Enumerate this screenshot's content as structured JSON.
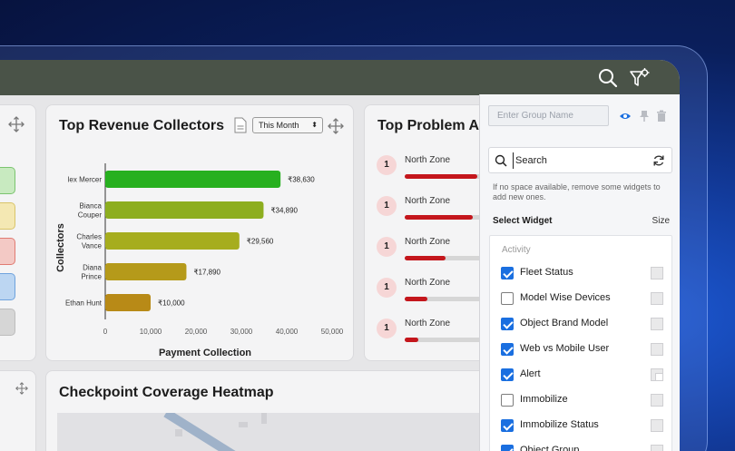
{
  "header": {
    "search_icon": "search-icon",
    "filter_settings_icon": "filter-settings-icon"
  },
  "revenue_card": {
    "title": "Top Revenue Collectors",
    "period_select": "This Month",
    "chart_data": {
      "type": "bar",
      "orientation": "horizontal",
      "categories": [
        "lex Mercer",
        "Bianca Couper",
        "Charles Vance",
        "Diana Prince",
        "Ethan Hunt"
      ],
      "category_lines": [
        [
          "lex Mercer"
        ],
        [
          "Bianca",
          "Couper"
        ],
        [
          "Charles",
          "Vance"
        ],
        [
          "Diana",
          "Prince"
        ],
        [
          "Ethan Hunt"
        ]
      ],
      "values": [
        38630,
        34890,
        29560,
        17890,
        10000
      ],
      "value_labels": [
        "₹38,630",
        "₹34,890",
        "₹29,560",
        "₹17,890",
        "₹10,000"
      ],
      "xlabel": "Payment Collection",
      "ylabel": "Collectors",
      "xlim": [
        0,
        50000
      ],
      "xticks": [
        "0",
        "10,000",
        "20,000",
        "30,000",
        "40,000",
        "50,000"
      ],
      "colors": [
        "#27b01f",
        "#8dae1f",
        "#a6ad1e",
        "#b59a1a",
        "#b88a17"
      ]
    }
  },
  "problem_card": {
    "title": "Top Problem Ar",
    "items": [
      {
        "rank": "1",
        "label": "North Zone",
        "fill": 0.8
      },
      {
        "rank": "1",
        "label": "North Zone",
        "fill": 0.75
      },
      {
        "rank": "1",
        "label": "North Zone",
        "fill": 0.45
      },
      {
        "rank": "1",
        "label": "North Zone",
        "fill": 0.25
      },
      {
        "rank": "1",
        "label": "North Zone",
        "fill": 0.15
      }
    ]
  },
  "heatmap_card": {
    "title": "Checkpoint Coverage Heatmap"
  },
  "legend_colors": [
    "#c8eac0",
    "#f4e8b3",
    "#f3c9c5",
    "#bcd6f2",
    "#d6d6d6"
  ],
  "panel": {
    "group_name_placeholder": "Enter Group Name",
    "search_placeholder": "Search",
    "note": "If no space available, remove some widgets to add new ones.",
    "select_widget_label": "Select Widget",
    "size_label": "Size",
    "group_label": "Activity",
    "widgets": [
      {
        "label": "Fleet Status",
        "checked": true,
        "size": "full"
      },
      {
        "label": "Model Wise Devices",
        "checked": false,
        "size": "full"
      },
      {
        "label": "Object Brand Model",
        "checked": true,
        "size": "full"
      },
      {
        "label": "Web vs Mobile User",
        "checked": true,
        "size": "full"
      },
      {
        "label": "Alert",
        "checked": true,
        "size": "partial"
      },
      {
        "label": "Immobilize",
        "checked": false,
        "size": "full"
      },
      {
        "label": "Immobilize Status",
        "checked": true,
        "size": "full"
      },
      {
        "label": "Object Group",
        "checked": true,
        "size": "full"
      }
    ]
  }
}
